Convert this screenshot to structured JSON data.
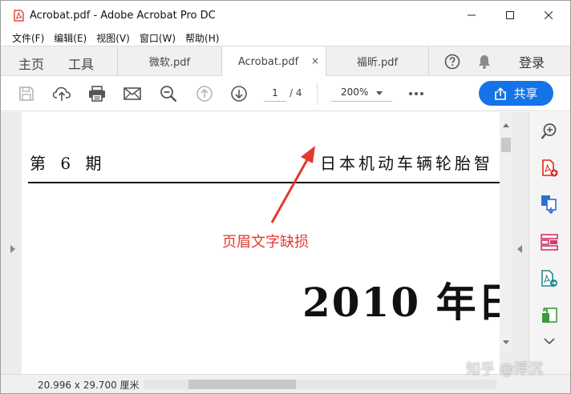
{
  "window": {
    "title": "Acrobat.pdf - Adobe Acrobat Pro DC"
  },
  "menu": [
    "文件(F)",
    "编辑(E)",
    "视图(V)",
    "窗口(W)",
    "帮助(H)"
  ],
  "tabbar": {
    "home": "主页",
    "tools": "工具",
    "tabs": [
      {
        "label": "微软.pdf"
      },
      {
        "label": "Acrobat.pdf",
        "close": "×"
      },
      {
        "label": "福昕.pdf"
      }
    ],
    "login": "登录"
  },
  "toolbar": {
    "page_current": "1",
    "page_total": "/ 4",
    "zoom": "200%",
    "share_label": "共享"
  },
  "document": {
    "issue": "第 6 期",
    "header_right": "日本机动车辆轮胎智",
    "big_text": "2010 年日"
  },
  "annotation": {
    "text": "页眉文字缺损"
  },
  "status": {
    "dimensions": "20.996 x 29.700 厘米"
  },
  "watermark": "知乎 @浮沉",
  "colors": {
    "accent": "#1473e6",
    "annotation": "#e03a2e",
    "tool_icon_red": "#d9261c",
    "tool_icon_blue": "#2b6fd6",
    "tool_icon_green": "#3c9a3c",
    "tool_icon_teal": "#1d8a8a",
    "tool_icon_pink": "#d6336c"
  }
}
